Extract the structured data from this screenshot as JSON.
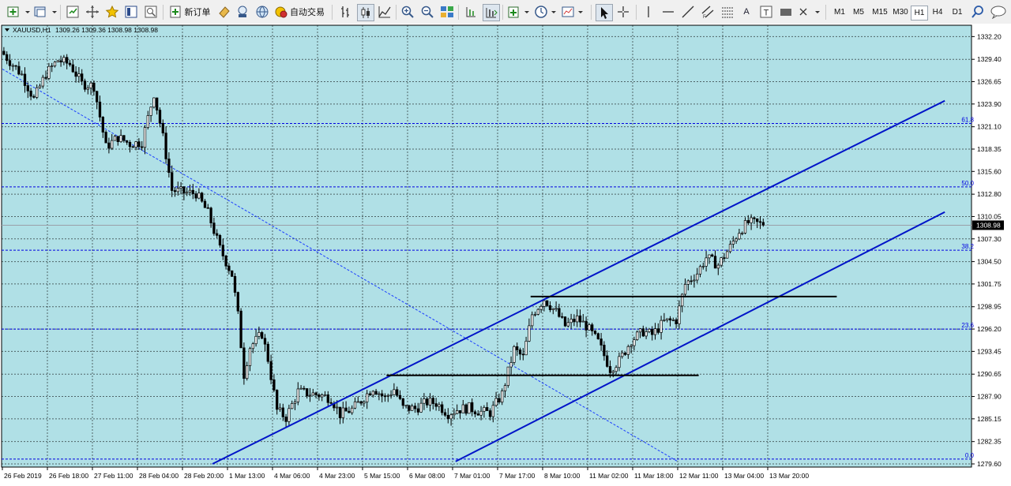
{
  "toolbar": {
    "new_order_label": "新订单",
    "auto_trading_label": "自动交易",
    "timeframes": [
      "M1",
      "M5",
      "M15",
      "M30",
      "H1",
      "H4",
      "D1"
    ],
    "active_timeframe": "H1",
    "text_tool_label": "A",
    "label_tool_label": "T"
  },
  "chart_data": {
    "type": "candlestick",
    "symbol_title": "XAUUSD,H1",
    "ohlc_header": "1309.26 1309.36 1308.98 1308.98",
    "current_price": 1308.98,
    "current_price_label": "1308.98",
    "ylim": [
      1279.6,
      1333.4
    ],
    "price_ticks": [
      "1332.20",
      "1329.40",
      "1326.65",
      "1323.90",
      "1321.10",
      "1318.35",
      "1315.60",
      "1312.80",
      "1310.05",
      "1307.30",
      "1304.50",
      "1301.75",
      "1298.95",
      "1296.20",
      "1293.45",
      "1290.65",
      "1287.90",
      "1285.15",
      "1282.35",
      "1279.60"
    ],
    "time_labels": [
      "26 Feb 2019",
      "26 Feb 18:00",
      "27 Feb 11:00",
      "28 Feb 04:00",
      "28 Feb 20:00",
      "1 Mar 13:00",
      "4 Mar 06:00",
      "4 Mar 23:00",
      "5 Mar 15:00",
      "6 Mar 08:00",
      "7 Mar 01:00",
      "7 Mar 17:00",
      "8 Mar 10:00",
      "11 Mar 02:00",
      "11 Mar 18:00",
      "12 Mar 11:00",
      "13 Mar 04:00",
      "13 Mar 20:00"
    ],
    "fibonacci_levels": [
      {
        "label": "61.8",
        "price": 1321.5
      },
      {
        "label": "50.0",
        "price": 1313.7
      },
      {
        "label": "38.2",
        "price": 1305.9
      },
      {
        "label": "23.6",
        "price": 1296.2
      },
      {
        "label": "0.0",
        "price": 1280.2
      }
    ],
    "horizontal_lines": [
      {
        "name": "resistance",
        "price": 1300.2,
        "from_bar": 176,
        "to_bar": 278
      },
      {
        "name": "support",
        "price": 1290.5,
        "from_bar": 128,
        "to_bar": 232
      }
    ],
    "channel_lines": [
      {
        "name": "channel-upper",
        "from": [
          70,
          1279.6
        ],
        "to": [
          314,
          1324.3
        ]
      },
      {
        "name": "channel-lower",
        "from": [
          151,
          1279.9
        ],
        "to": [
          314,
          1310.6
        ]
      }
    ],
    "trend_line": {
      "name": "fib-trendline",
      "from": [
        0,
        1328.2
      ],
      "to": [
        225,
        1279.9
      ]
    },
    "path": [
      [
        0,
        1330.0
      ],
      [
        6,
        1327.5
      ],
      [
        10,
        1324.5
      ],
      [
        14,
        1327.6
      ],
      [
        18,
        1329.3
      ],
      [
        22,
        1328.8
      ],
      [
        26,
        1326.4
      ],
      [
        30,
        1326.1
      ],
      [
        34,
        1318.6
      ],
      [
        38,
        1319.8
      ],
      [
        42,
        1319.0
      ],
      [
        46,
        1319.2
      ],
      [
        50,
        1325.2
      ],
      [
        53,
        1319.8
      ],
      [
        56,
        1313.3
      ],
      [
        60,
        1313.0
      ],
      [
        64,
        1312.9
      ],
      [
        68,
        1310.5
      ],
      [
        72,
        1306.1
      ],
      [
        76,
        1302.9
      ],
      [
        78,
        1297.9
      ],
      [
        80,
        1290.6
      ],
      [
        82,
        1294.0
      ],
      [
        86,
        1295.6
      ],
      [
        88,
        1292.5
      ],
      [
        91,
        1286.2
      ],
      [
        94,
        1285.3
      ],
      [
        98,
        1288.5
      ],
      [
        101,
        1288.3
      ],
      [
        105,
        1288.1
      ],
      [
        109,
        1287.7
      ],
      [
        112,
        1285.7
      ],
      [
        116,
        1286.3
      ],
      [
        119,
        1287.4
      ],
      [
        123,
        1289.0
      ],
      [
        127,
        1287.7
      ],
      [
        130,
        1288.8
      ],
      [
        133,
        1286.5
      ],
      [
        137,
        1286.4
      ],
      [
        141,
        1287.2
      ],
      [
        144,
        1287.1
      ],
      [
        148,
        1285.8
      ],
      [
        151,
        1286.3
      ],
      [
        155,
        1286.5
      ],
      [
        159,
        1286.0
      ],
      [
        162,
        1285.9
      ],
      [
        166,
        1288.2
      ],
      [
        170,
        1293.7
      ],
      [
        173,
        1292.7
      ],
      [
        176,
        1298.0
      ],
      [
        180,
        1299.9
      ],
      [
        184,
        1298.3
      ],
      [
        187,
        1296.6
      ],
      [
        191,
        1297.5
      ],
      [
        194,
        1296.6
      ],
      [
        198,
        1294.6
      ],
      [
        202,
        1291.3
      ],
      [
        205,
        1292.3
      ],
      [
        209,
        1294.8
      ],
      [
        213,
        1295.9
      ],
      [
        216,
        1295.5
      ],
      [
        220,
        1297.1
      ],
      [
        224,
        1297.3
      ],
      [
        227,
        1301.7
      ],
      [
        231,
        1303.1
      ],
      [
        234,
        1305.0
      ],
      [
        238,
        1304.1
      ],
      [
        242,
        1306.3
      ],
      [
        245,
        1308.3
      ],
      [
        248,
        1309.3
      ],
      [
        251,
        1309.2
      ],
      [
        253,
        1309.0
      ]
    ]
  }
}
